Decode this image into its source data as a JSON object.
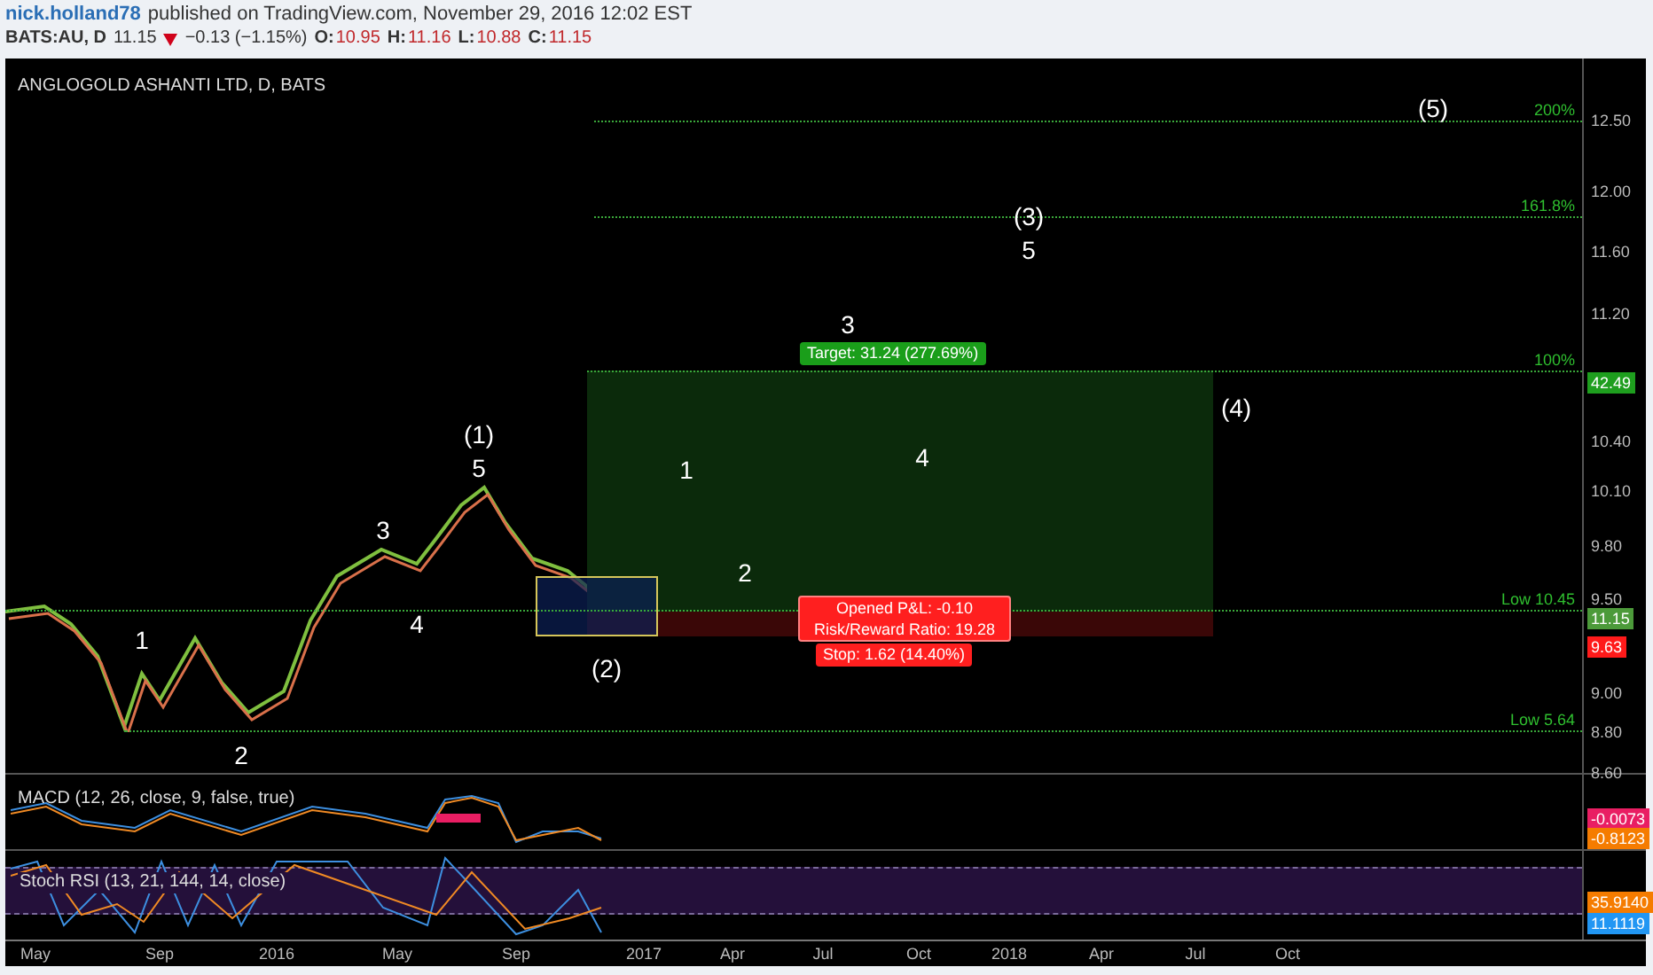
{
  "header": {
    "author": "nick.holland78",
    "published": "published on TradingView.com, November 29, 2016 12:02 EST"
  },
  "quote": {
    "symbol": "BATS:AU, D",
    "last": "11.15",
    "falling": true,
    "change": "−0.13 (−1.15%)",
    "ohlc": [
      {
        "label": "O:",
        "value": "10.95"
      },
      {
        "label": "H:",
        "value": "11.16"
      },
      {
        "label": "L:",
        "value": "10.88"
      },
      {
        "label": "C:",
        "value": "11.15"
      }
    ]
  },
  "chart": {
    "title": "ANGLOGOLD ASHANTI LTD, D, BATS",
    "wave_labels": [
      "(5)",
      "(3)",
      "5",
      "3",
      "(4)",
      "4",
      "1",
      "2",
      "(1)",
      "5",
      "3",
      "4",
      "1",
      "2",
      "(2)"
    ],
    "fib_levels": [
      {
        "label": "200%"
      },
      {
        "label": "161.8%"
      },
      {
        "label": "100%"
      },
      {
        "label": "Low 10.45"
      },
      {
        "label": "Low 5.64"
      }
    ],
    "position": {
      "target": "Target: 31.24 (277.69%)",
      "pnl": "Opened P&L: -0.10",
      "risk_reward": "Risk/Reward Ratio: 19.28",
      "stop": "Stop: 1.62 (14.40%)"
    }
  },
  "price_axis": [
    {
      "kind": "tick",
      "label": "12.50"
    },
    {
      "kind": "tick",
      "label": "12.00"
    },
    {
      "kind": "tick",
      "label": "11.60"
    },
    {
      "kind": "tick",
      "label": "11.20"
    },
    {
      "kind": "badge",
      "label": "42.49",
      "color": "#1e9e1e"
    },
    {
      "kind": "tick",
      "label": "10.40"
    },
    {
      "kind": "tick",
      "label": "10.10"
    },
    {
      "kind": "tick",
      "label": "9.80"
    },
    {
      "kind": "tick",
      "label": "9.50"
    },
    {
      "kind": "badge",
      "label": "11.15",
      "color": "#4c9a3a"
    },
    {
      "kind": "badge",
      "label": "9.63",
      "color": "#ff1a1a"
    },
    {
      "kind": "tick",
      "label": "9.00"
    },
    {
      "kind": "tick",
      "label": "8.80"
    },
    {
      "kind": "tick",
      "label": "8.60"
    }
  ],
  "macd": {
    "title": "MACD (12, 26, close, 9, false, true)",
    "axis": [
      {
        "label": "-0.0073",
        "color": "#e91e63"
      },
      {
        "label": "-0.8123",
        "color": "#f57c00"
      }
    ]
  },
  "stoch_rsi": {
    "title": "Stoch RSI (13, 21, 144, 14, close)",
    "axis": [
      {
        "label": "35.9140",
        "color": "#f57c00"
      },
      {
        "label": "11.1119",
        "color": "#2196f3"
      }
    ]
  },
  "time_axis": [
    "May",
    "Sep",
    "2016",
    "May",
    "Sep",
    "2017",
    "Apr",
    "Jul",
    "Oct",
    "2018",
    "Apr",
    "Jul",
    "Oct"
  ]
}
